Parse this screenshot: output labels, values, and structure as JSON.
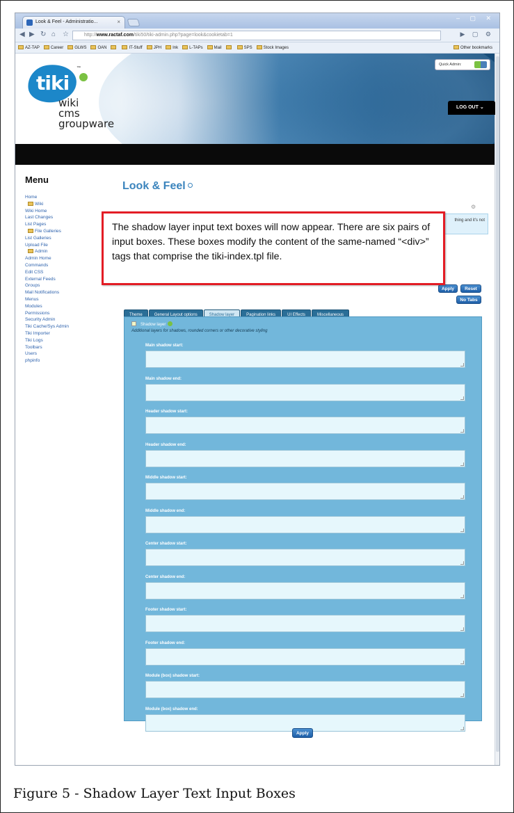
{
  "browser": {
    "tab_title": "Look & Feel - Administratio...",
    "tab_close": "×",
    "window_controls": "– ▢ ✕",
    "url_prefix": "http://",
    "url_host": "www.ractaf.com",
    "url_path": "/tiki50/tiki-admin.php?page=look&cookietab=1",
    "bookmarks": [
      "AZ-TAP",
      "Career",
      "GLWS",
      "OAN",
      "",
      "IT-Stuff",
      "JPH",
      "Ink",
      "L-TAPs",
      "Mail",
      "",
      "SPS",
      "Stock Images",
      "Other bookmarks"
    ]
  },
  "header": {
    "logo_tiki": "tiki",
    "logo_tm": "™",
    "logo_lines": [
      "wiki",
      "cms",
      "groupware"
    ],
    "quick_admin": "Quick Admin:",
    "logout": "LOG OUT ⌄"
  },
  "sidebar": {
    "title": "Menu",
    "items": [
      {
        "label": "Home",
        "folder": false
      },
      {
        "label": "Wiki",
        "folder": true
      },
      {
        "label": "Wiki Home",
        "folder": false
      },
      {
        "label": "Last Changes",
        "folder": false
      },
      {
        "label": "List Pages",
        "folder": false
      },
      {
        "label": "File Galleries",
        "folder": true
      },
      {
        "label": "List Galleries",
        "folder": false
      },
      {
        "label": "Upload File",
        "folder": false
      },
      {
        "label": "Admin",
        "folder": true
      },
      {
        "label": "Admin Home",
        "folder": false
      },
      {
        "label": "Commands",
        "folder": false
      },
      {
        "label": "Edit CSS",
        "folder": false
      },
      {
        "label": "External Feeds",
        "folder": false
      },
      {
        "label": "Groups",
        "folder": false
      },
      {
        "label": "Mail Notifications",
        "folder": false
      },
      {
        "label": "Menus",
        "folder": false
      },
      {
        "label": "Modules",
        "folder": false
      },
      {
        "label": "Permissions",
        "folder": false
      },
      {
        "label": "Security Admin",
        "folder": false
      },
      {
        "label": "Tiki Cache/Sys Admin",
        "folder": false
      },
      {
        "label": "Tiki Importer",
        "folder": false
      },
      {
        "label": "Tiki Logs",
        "folder": false
      },
      {
        "label": "Toolbars",
        "folder": false
      },
      {
        "label": "Users",
        "folder": false
      },
      {
        "label": "phpinfo",
        "folder": false
      }
    ]
  },
  "main": {
    "title": "Look & Feel",
    "info_text": "thing and it's not",
    "apply_label": "Apply",
    "reset_label": "Reset",
    "no_tabs_label": "No Tabs",
    "tabs": [
      "Theme",
      "General Layout options",
      "Shadow layer",
      "Pagination links",
      "UI Effects",
      "Miscellaneous"
    ],
    "active_tab": "Shadow layer",
    "panel": {
      "heading": "Shadow layer",
      "subtitle": "Additional layers for shadows, rounded corners or other decorative styling",
      "fields": [
        {
          "label": "Main shadow start:",
          "value": ""
        },
        {
          "label": "Main shadow end:",
          "value": ""
        },
        {
          "label": "Header shadow start:",
          "value": ""
        },
        {
          "label": "Header shadow end:",
          "value": ""
        },
        {
          "label": "Middle shadow start:",
          "value": ""
        },
        {
          "label": "Middle shadow end:",
          "value": ""
        },
        {
          "label": "Center shadow start:",
          "value": ""
        },
        {
          "label": "Center shadow end:",
          "value": ""
        },
        {
          "label": "Footer shadow start:",
          "value": ""
        },
        {
          "label": "Footer shadow end:",
          "value": ""
        },
        {
          "label": "Module (box) shadow start:",
          "value": ""
        },
        {
          "label": "Module (box) shadow end:",
          "value": ""
        }
      ]
    },
    "bottom_apply_label": "Apply"
  },
  "callout": {
    "text": "The shadow layer input text boxes will now appear.  There are six pairs of input boxes.  These boxes modify the content of the same-named “<div>” tags that comprise the tiki-index.tpl file.",
    "border_color": "#e31c25"
  },
  "caption": "Figure 5 - Shadow Layer Text Input Boxes"
}
